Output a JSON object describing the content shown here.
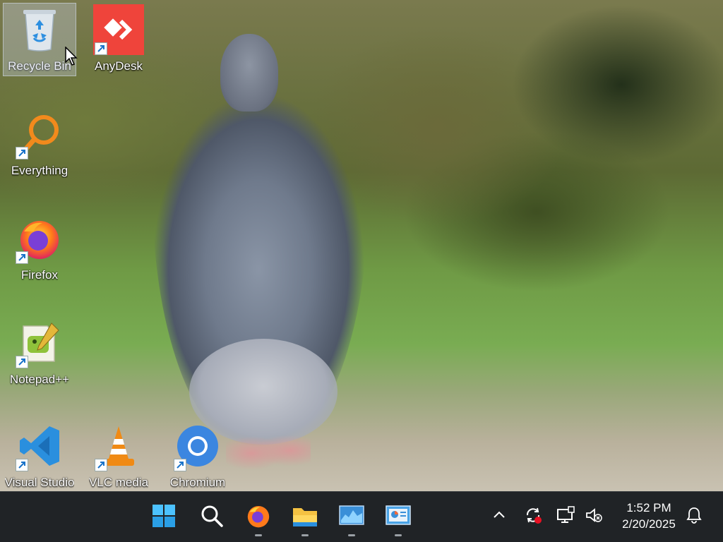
{
  "desktop": {
    "icons": [
      {
        "label": "Recycle Bin",
        "icon": "recycle-bin-icon"
      },
      {
        "label": "AnyDesk",
        "icon": "anydesk-icon"
      },
      {
        "label": "Everything",
        "icon": "everything-search-icon"
      },
      {
        "label": "Firefox",
        "icon": "firefox-icon"
      },
      {
        "label": "Notepad++",
        "icon": "notepad-plus-plus-icon"
      },
      {
        "label": "Visual Studio",
        "icon": "vscode-icon"
      },
      {
        "label": "VLC media",
        "icon": "vlc-icon"
      },
      {
        "label": "Chromium",
        "icon": "chromium-icon"
      }
    ]
  },
  "taskbar": {
    "apps": [
      {
        "name": "Start",
        "icon": "windows-start-icon"
      },
      {
        "name": "Search",
        "icon": "search-icon"
      },
      {
        "name": "Firefox",
        "icon": "firefox-icon"
      },
      {
        "name": "File Explorer",
        "icon": "file-explorer-icon"
      },
      {
        "name": "Performance Monitor",
        "icon": "monitor-graph-icon"
      },
      {
        "name": "Control Panel",
        "icon": "control-panel-icon"
      }
    ],
    "tray": {
      "icons": [
        "chevron-up-icon",
        "sync-icon",
        "network-icon",
        "volume-muted-icon",
        "notification-bell-icon"
      ],
      "time": "1:52 PM",
      "date": "2/20/2025"
    }
  },
  "colors": {
    "taskbar_bg": "#202326",
    "anydesk_red": "#ef443b",
    "everything_orange": "#f28a1c",
    "vscode_blue": "#2a8fde",
    "vlc_orange": "#f08a14"
  }
}
